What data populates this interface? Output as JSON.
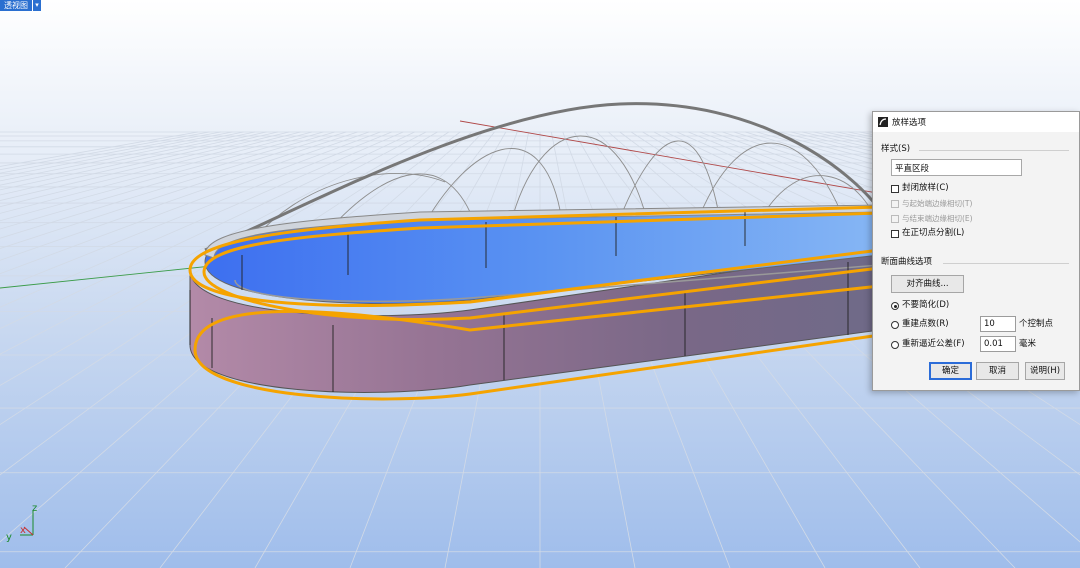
{
  "viewport": {
    "tab_label": "透视图",
    "tab_arrow": "▾",
    "axis_z": "z",
    "axis_x": "x",
    "axis_y": "y"
  },
  "dialog": {
    "title": "放样选项",
    "style_label": "样式(S)",
    "style_value": "平直区段",
    "closed_loft_label": "封闭放样(C)",
    "tangent_start_label": "与起始端边缘相切(T)",
    "tangent_end_label": "与结束端边缘相切(E)",
    "split_kinks_label": "在正切点分割(L)",
    "section_label": "断面曲线选项",
    "align_button": "对齐曲线...",
    "no_simplify_label": "不要简化(D)",
    "rebuild_label": "重建点数(R)",
    "rebuild_value": "10",
    "rebuild_unit": "个控制点",
    "refit_label": "重新逼近公差(F)",
    "refit_value": "0.01",
    "refit_unit": "毫米",
    "ok_button": "确定",
    "cancel_button": "取消",
    "help_button": "说明(H)",
    "selected_option": "no_simplify"
  },
  "colors": {
    "selection": "#f5a300",
    "surface_inner": "#5a8ff0",
    "surface_outer": "#9c7e98",
    "grid": "#d3dbe6",
    "accent": "#2a6fd0"
  }
}
